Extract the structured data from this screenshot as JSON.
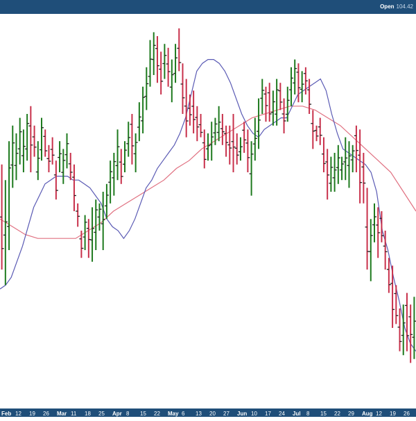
{
  "header": {
    "open_label": "Open",
    "open_value": "104.42"
  },
  "colors": {
    "background": "#ffffff",
    "frame": "#1f4e79",
    "up_bar": "#1e7a1e",
    "down_bar": "#c8304a",
    "ma_short": "#5a5ab4",
    "ma_long": "#e07080"
  },
  "chart_data": {
    "type": "ohlc",
    "title": "",
    "xlabel": "",
    "ylabel": "",
    "x_tick_labels": [
      "Feb",
      "12",
      "19",
      "26",
      "Mar",
      "11",
      "18",
      "25",
      "Apr",
      "8",
      "15",
      "22",
      "May",
      "6",
      "13",
      "20",
      "27",
      "Jun",
      "10",
      "17",
      "24",
      "Jul",
      "8",
      "15",
      "22",
      "29",
      "Aug",
      "12",
      "19",
      "26"
    ],
    "month_labels": [
      "Feb",
      "Mar",
      "Apr",
      "May",
      "Jun",
      "Jul",
      "Aug"
    ],
    "grid": false,
    "ylim": [
      0,
      100
    ],
    "y_scale_note": "no price axis shown; values are relative (0 = bottom, 100 = top of plot)",
    "bars": [
      [
        62,
        35
      ],
      [
        58,
        31
      ],
      [
        68,
        40
      ],
      [
        72,
        56
      ],
      [
        70,
        58
      ],
      [
        74,
        62
      ],
      [
        71,
        60
      ],
      [
        75,
        63
      ],
      [
        77,
        60
      ],
      [
        72,
        64
      ],
      [
        68,
        58
      ],
      [
        74,
        63
      ],
      [
        71,
        64
      ],
      [
        67,
        60
      ],
      [
        69,
        62
      ],
      [
        63,
        53
      ],
      [
        68,
        60
      ],
      [
        66,
        57
      ],
      [
        70,
        61
      ],
      [
        65,
        58
      ],
      [
        62,
        50
      ],
      [
        52,
        46
      ],
      [
        45,
        38
      ],
      [
        49,
        40
      ],
      [
        48,
        38
      ],
      [
        51,
        37
      ],
      [
        53,
        40
      ],
      [
        52,
        45
      ],
      [
        55,
        40
      ],
      [
        57,
        48
      ],
      [
        63,
        52
      ],
      [
        65,
        54
      ],
      [
        71,
        58
      ],
      [
        66,
        57
      ],
      [
        68,
        60
      ],
      [
        73,
        64
      ],
      [
        75,
        62
      ],
      [
        70,
        60
      ],
      [
        78,
        68
      ],
      [
        82,
        70
      ],
      [
        87,
        76
      ],
      [
        94,
        82
      ],
      [
        96,
        85
      ],
      [
        95,
        83
      ],
      [
        91,
        80
      ],
      [
        93,
        84
      ],
      [
        92,
        82
      ],
      [
        89,
        78
      ],
      [
        93,
        83
      ],
      [
        97,
        86
      ],
      [
        88,
        75
      ],
      [
        84,
        69
      ],
      [
        80,
        72
      ],
      [
        81,
        70
      ],
      [
        77,
        68
      ],
      [
        75,
        69
      ],
      [
        71,
        61
      ],
      [
        70,
        63
      ],
      [
        73,
        63
      ],
      [
        74,
        67
      ],
      [
        77,
        68
      ],
      [
        75,
        67
      ],
      [
        72,
        64
      ],
      [
        72,
        62
      ],
      [
        75,
        60
      ],
      [
        70,
        62
      ],
      [
        69,
        63
      ],
      [
        73,
        65
      ],
      [
        71,
        60
      ],
      [
        68,
        54
      ],
      [
        74,
        63
      ],
      [
        79,
        66
      ],
      [
        84,
        75
      ],
      [
        82,
        73
      ],
      [
        83,
        73
      ],
      [
        81,
        72
      ],
      [
        84,
        72
      ],
      [
        83,
        76
      ],
      [
        79,
        70
      ],
      [
        82,
        73
      ],
      [
        87,
        77
      ],
      [
        89,
        80
      ],
      [
        88,
        78
      ],
      [
        86,
        78
      ],
      [
        87,
        80
      ],
      [
        84,
        75
      ],
      [
        76,
        66
      ],
      [
        72,
        68
      ],
      [
        74,
        67
      ],
      [
        69,
        60
      ],
      [
        66,
        53
      ],
      [
        64,
        55
      ],
      [
        65,
        55
      ],
      [
        67,
        57
      ],
      [
        64,
        58
      ],
      [
        69,
        58
      ],
      [
        68,
        56
      ],
      [
        67,
        60
      ],
      [
        72,
        60
      ],
      [
        71,
        52
      ],
      [
        65,
        52
      ],
      [
        56,
        35
      ],
      [
        48,
        32
      ],
      [
        52,
        42
      ],
      [
        51,
        38
      ],
      [
        50,
        42
      ],
      [
        45,
        35
      ],
      [
        38,
        29
      ],
      [
        36,
        20
      ],
      [
        31,
        21
      ],
      [
        25,
        14
      ],
      [
        26,
        13
      ],
      [
        29,
        14
      ],
      [
        26,
        11
      ],
      [
        28,
        12
      ]
    ],
    "ma_short": [
      30,
      31,
      33,
      37,
      41,
      46,
      51,
      54,
      57,
      58,
      59,
      59,
      59,
      58,
      58,
      57,
      56,
      54,
      52,
      48,
      46,
      45,
      43,
      45,
      48,
      52,
      56,
      58,
      61,
      63,
      65,
      67,
      70,
      74,
      80,
      86,
      88,
      89,
      89,
      88,
      86,
      83,
      79,
      75,
      72,
      70,
      69,
      71,
      72,
      73,
      74,
      74,
      77,
      80,
      81,
      82,
      83,
      84,
      81,
      75,
      70,
      66,
      65,
      64,
      63,
      62,
      60,
      55,
      45,
      40,
      33,
      27,
      20,
      16,
      14
    ],
    "ma_long": [
      48,
      46,
      44,
      43,
      43,
      43,
      43,
      45,
      47,
      50,
      52,
      54,
      56,
      58,
      61,
      63,
      66,
      68,
      70,
      72,
      74,
      75,
      76,
      77,
      77,
      76,
      74,
      72,
      69,
      66,
      63,
      60,
      55,
      50
    ]
  }
}
